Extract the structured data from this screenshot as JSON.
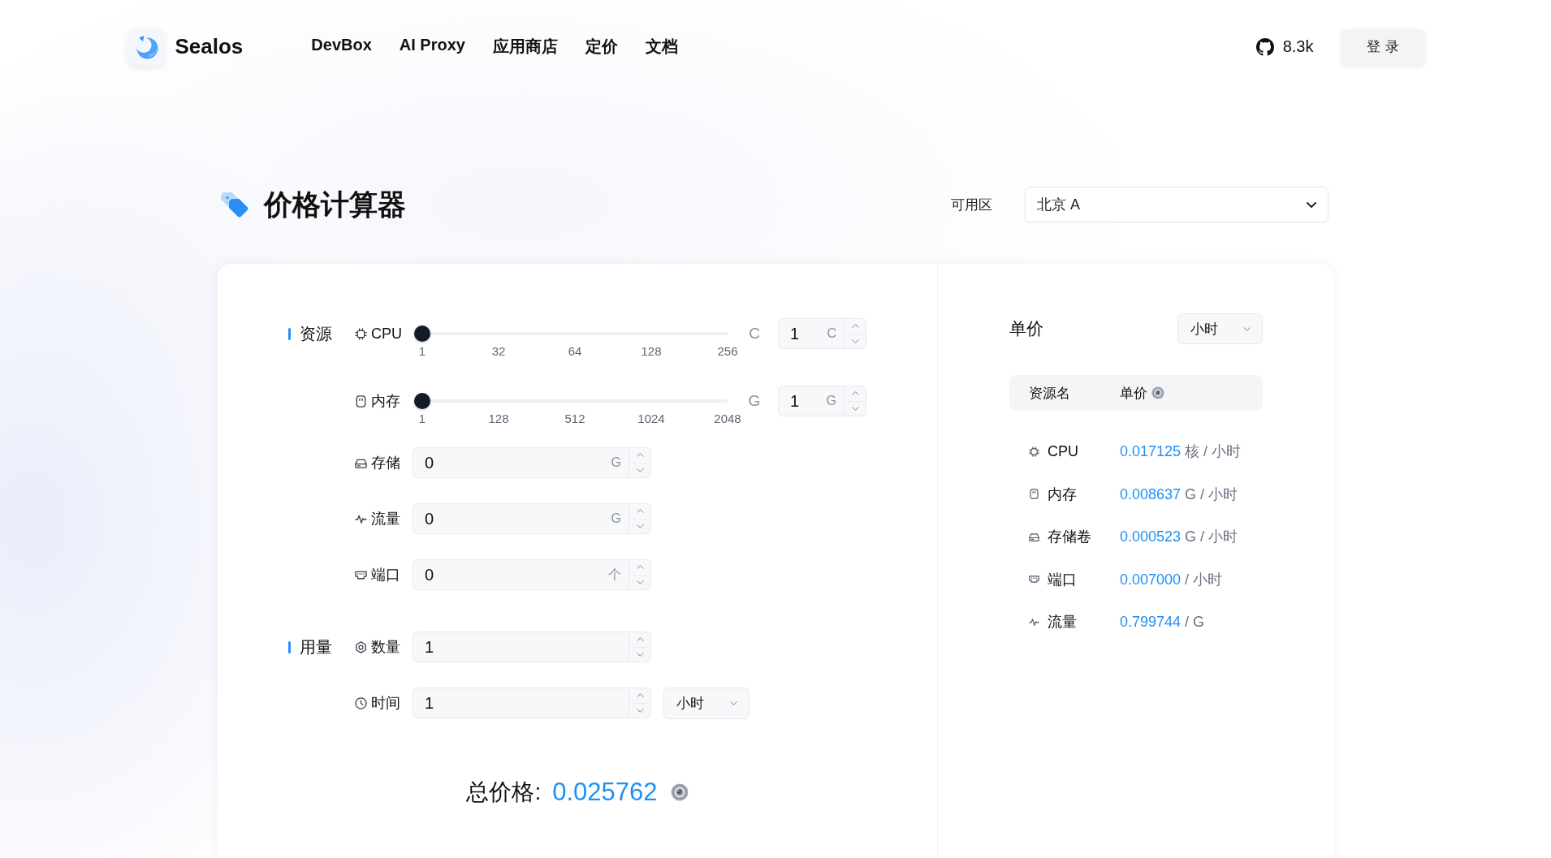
{
  "header": {
    "brand": "Sealos",
    "nav": [
      {
        "label": "DevBox"
      },
      {
        "label": "AI Proxy"
      },
      {
        "label": "应用商店"
      },
      {
        "label": "定价"
      },
      {
        "label": "文档"
      }
    ],
    "github_stars": "8.3k",
    "login_button": "登录"
  },
  "page": {
    "title": "价格计算器",
    "zone": {
      "label": "可用区",
      "value": "北京 A"
    }
  },
  "calculator": {
    "resources": {
      "label": "资源",
      "items": [
        {
          "kind": "slider",
          "name": "CPU",
          "level": 0,
          "ticks": [
            "1",
            "32",
            "64",
            "128",
            "256"
          ],
          "unit": "C",
          "value": "1",
          "suffix": "C"
        },
        {
          "kind": "slider",
          "name": "内存",
          "level": 0,
          "ticks": [
            "1",
            "128",
            "512",
            "1024",
            "2048"
          ],
          "unit": "G",
          "value": "1",
          "suffix": "G"
        },
        {
          "kind": "number",
          "name": "存储",
          "value": "0",
          "suffix": "G"
        },
        {
          "kind": "number",
          "name": "流量",
          "value": "0",
          "suffix": "G"
        },
        {
          "kind": "number",
          "name": "端口",
          "value": "0",
          "suffix": "个"
        }
      ]
    },
    "usage": {
      "label": "用量",
      "items": [
        {
          "name": "数量",
          "value": "1"
        },
        {
          "name": "时间",
          "value": "1",
          "period": "小时"
        }
      ]
    },
    "total": {
      "label": "总价格:",
      "value": "0.025762"
    }
  },
  "unit_prices": {
    "title": "单价",
    "period": "小时",
    "columns": [
      "资源名",
      "单价"
    ],
    "rows": [
      {
        "name": "CPU",
        "price": "0.017125",
        "unit": "核 / 小时"
      },
      {
        "name": "内存",
        "price": "0.008637",
        "unit": "G / 小时"
      },
      {
        "name": "存储卷",
        "price": "0.000523",
        "unit": "G / 小时"
      },
      {
        "name": "端口",
        "price": "0.007000",
        "unit": "/ 小时"
      },
      {
        "name": "流量",
        "price": "0.799744",
        "unit": "/ G"
      }
    ]
  }
}
